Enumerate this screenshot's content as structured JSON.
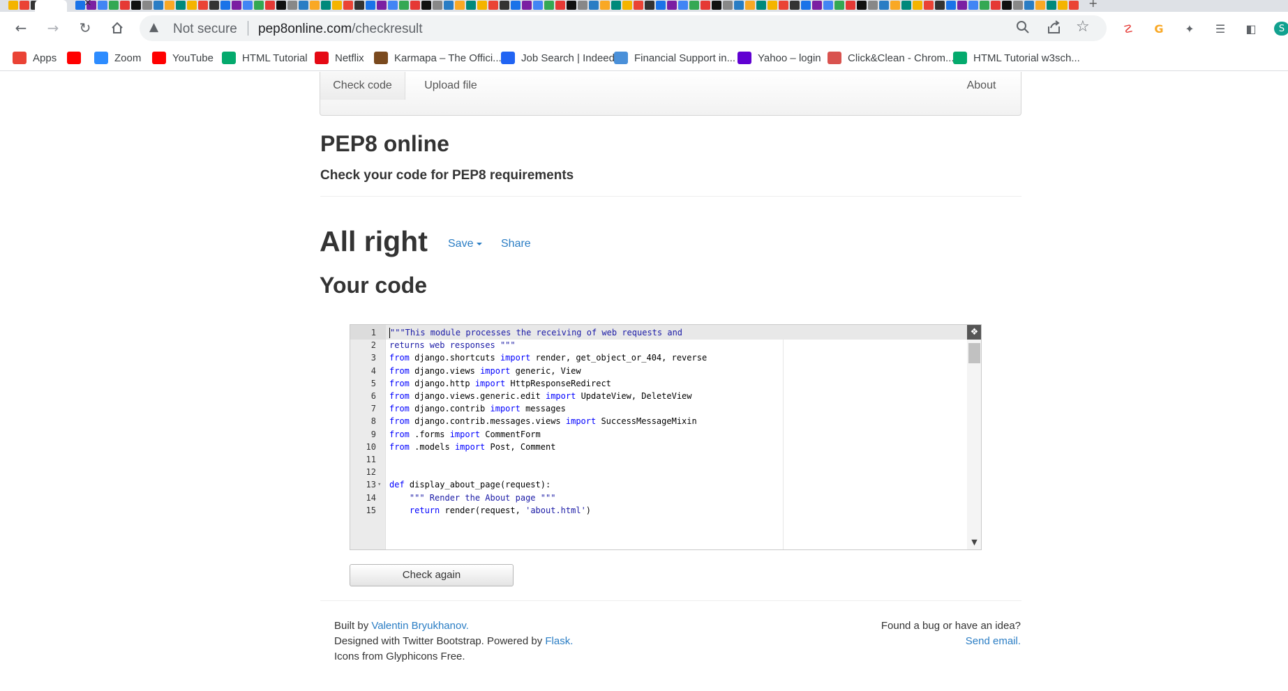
{
  "browser": {
    "tab_close": "×",
    "tab_new": "+",
    "security_label": "Not secure",
    "url_host": "pep8online.com",
    "url_path": "/checkresult",
    "bookmarks": [
      {
        "label": "Apps",
        "icon": "apps-grid-icon",
        "color": "#ea4335"
      },
      {
        "label": "",
        "icon": "youtube-icon",
        "color": "#ff0000"
      },
      {
        "label": "Zoom",
        "icon": "zoom-icon",
        "color": "#2d8cff"
      },
      {
        "label": "YouTube",
        "icon": "youtube-icon",
        "color": "#ff0000"
      },
      {
        "label": "HTML Tutorial",
        "icon": "w3schools-icon",
        "color": "#04aa6d"
      },
      {
        "label": "Netflix",
        "icon": "netflix-icon",
        "color": "#e50914"
      },
      {
        "label": "Karmapa – The Offici...",
        "icon": "karmapa-icon",
        "color": "#7a4a1e"
      },
      {
        "label": "Job Search | Indeed",
        "icon": "indeed-icon",
        "color": "#2164f3"
      },
      {
        "label": "Financial Support in...",
        "icon": "shield-icon",
        "color": "#4a90d9"
      },
      {
        "label": "Yahoo – login",
        "icon": "yahoo-icon",
        "color": "#6001d2"
      },
      {
        "label": "Click&Clean - Chrom...",
        "icon": "clickclean-icon",
        "color": "#d9534f"
      },
      {
        "label": "HTML Tutorial w3sch...",
        "icon": "w3schools-icon",
        "color": "#04aa6d"
      }
    ]
  },
  "nav": {
    "check_code": "Check code",
    "upload_file": "Upload file",
    "about": "About"
  },
  "header": {
    "title": "PEP8 online",
    "subtitle": "Check your code for PEP8 requirements"
  },
  "result": {
    "status": "All right",
    "save_label": "Save",
    "share_label": "Share",
    "code_heading": "Your code"
  },
  "editor": {
    "lines": [
      {
        "n": "1",
        "html": "<span class=\"cursor\"></span><span class=\"str\">\"\"\"This module processes the receiving of web requests and</span>"
      },
      {
        "n": "2",
        "html": "<span class=\"str\">returns web responses \"\"\"</span>"
      },
      {
        "n": "3",
        "html": "<span class=\"k\">from</span> django.shortcuts <span class=\"k\">import</span> render, get_object_or_404, reverse"
      },
      {
        "n": "4",
        "html": "<span class=\"k\">from</span> django.views <span class=\"k\">import</span> generic, View"
      },
      {
        "n": "5",
        "html": "<span class=\"k\">from</span> django.http <span class=\"k\">import</span> HttpResponseRedirect"
      },
      {
        "n": "6",
        "html": "<span class=\"k\">from</span> django.views.generic.edit <span class=\"k\">import</span> UpdateView, DeleteView"
      },
      {
        "n": "7",
        "html": "<span class=\"k\">from</span> django.contrib <span class=\"k\">import</span> messages"
      },
      {
        "n": "8",
        "html": "<span class=\"k\">from</span> django.contrib.messages.views <span class=\"k\">import</span> SuccessMessageMixin"
      },
      {
        "n": "9",
        "html": "<span class=\"k\">from</span> .forms <span class=\"k\">import</span> CommentForm"
      },
      {
        "n": "10",
        "html": "<span class=\"k\">from</span> .models <span class=\"k\">import</span> Post, Comment"
      },
      {
        "n": "11",
        "html": ""
      },
      {
        "n": "12",
        "html": ""
      },
      {
        "n": "13",
        "html": "<span class=\"k\">def</span> display_about_page(request):",
        "fold": true
      },
      {
        "n": "14",
        "html": "    <span class=\"str\">\"\"\" Render the About page \"\"\"</span>"
      },
      {
        "n": "15",
        "html": "    <span class=\"k\">return</span> render(request, <span class=\"str\">'about.html'</span>)"
      }
    ]
  },
  "actions": {
    "check_again": "Check again"
  },
  "footer": {
    "built_by": "Built by ",
    "author": "Valentin Bryukhanov.",
    "designed": "Designed with Twitter Bootstrap. Powered by ",
    "flask": "Flask.",
    "icons": "Icons from Glyphicons Free.",
    "bug_text": "Found a bug or have an idea?",
    "send_email": "Send email."
  },
  "colors": {
    "link": "#2a7dc4",
    "heading": "#333333",
    "keyword": "#0000ff",
    "string": "#1a1aa6"
  }
}
